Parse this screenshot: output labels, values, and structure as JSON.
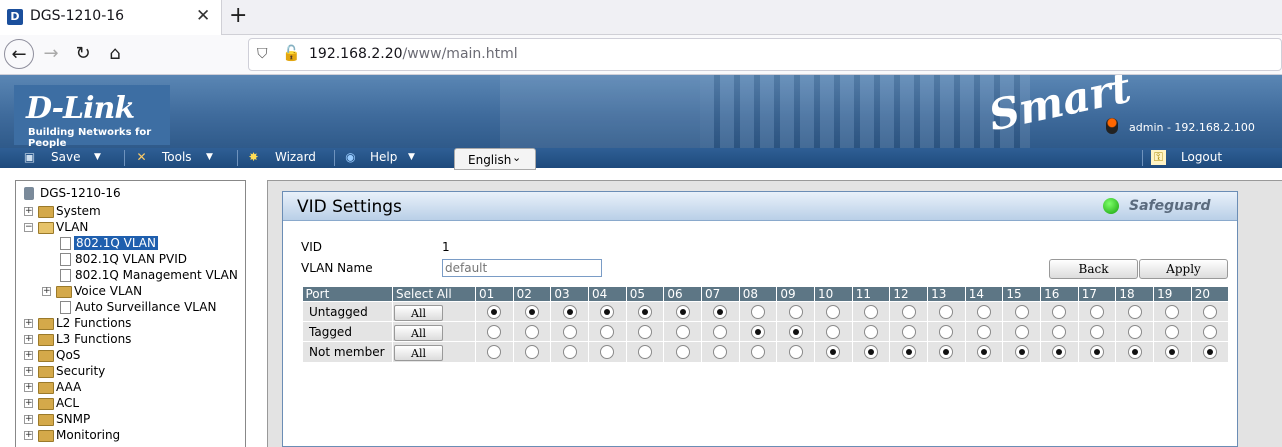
{
  "browser": {
    "tab_title": "DGS-1210-16",
    "favicon_letter": "D",
    "url_host": "192.168.2.20",
    "url_path": "/www/main.html"
  },
  "header": {
    "logo": "D-Link",
    "logo_sub": "Building Networks for People",
    "brand_mark": "Smart",
    "admin_info": "admin - 192.168.2.100"
  },
  "menu": {
    "save": "Save",
    "tools": "Tools",
    "wizard": "Wizard",
    "help": "Help",
    "language": "English",
    "logout": "Logout"
  },
  "tree": {
    "root": "DGS-1210-16",
    "system": "System",
    "vlan": "VLAN",
    "vlan_8021q": "802.1Q VLAN",
    "vlan_pvid": "802.1Q VLAN PVID",
    "vlan_mgmt": "802.1Q Management VLAN",
    "voice_vlan": "Voice VLAN",
    "auto_surv": "Auto Surveillance VLAN",
    "l2": "L2 Functions",
    "l3": "L3 Functions",
    "qos": "QoS",
    "security": "Security",
    "aaa": "AAA",
    "acl": "ACL",
    "snmp": "SNMP",
    "monitoring": "Monitoring"
  },
  "panel": {
    "title": "VID Settings",
    "safeguard": "Safeguard",
    "vid_label": "VID",
    "vid_value": "1",
    "vlan_name_label": "VLAN Name",
    "vlan_name_placeholder": "default",
    "back": "Back",
    "apply": "Apply"
  },
  "table": {
    "col_port": "Port",
    "col_select_all": "Select All",
    "all_label": "All",
    "ports": [
      "01",
      "02",
      "03",
      "04",
      "05",
      "06",
      "07",
      "08",
      "09",
      "10",
      "11",
      "12",
      "13",
      "14",
      "15",
      "16",
      "17",
      "18",
      "19",
      "20"
    ],
    "rows": [
      {
        "label": "Untagged",
        "selected": [
          true,
          true,
          true,
          true,
          true,
          true,
          true,
          false,
          false,
          false,
          false,
          false,
          false,
          false,
          false,
          false,
          false,
          false,
          false,
          false
        ]
      },
      {
        "label": "Tagged",
        "selected": [
          false,
          false,
          false,
          false,
          false,
          false,
          false,
          true,
          true,
          false,
          false,
          false,
          false,
          false,
          false,
          false,
          false,
          false,
          false,
          false
        ]
      },
      {
        "label": "Not member",
        "selected": [
          false,
          false,
          false,
          false,
          false,
          false,
          false,
          false,
          false,
          true,
          true,
          true,
          true,
          true,
          true,
          true,
          true,
          true,
          true,
          true
        ]
      }
    ]
  }
}
